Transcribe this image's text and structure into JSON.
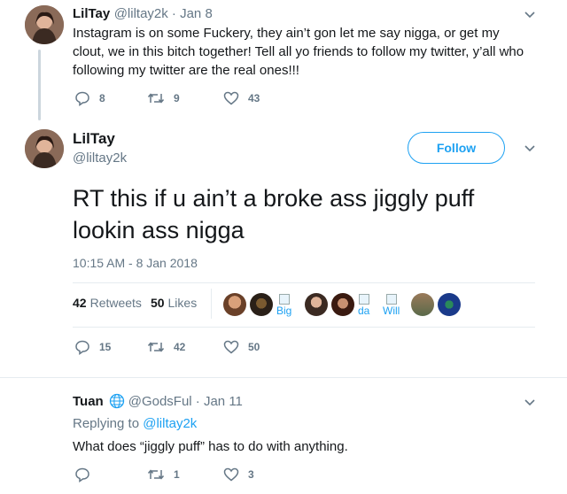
{
  "tweet1": {
    "name": "LilTay",
    "handle_date": "@liltay2k · Jan 8",
    "text": "Instagram is on some Fuckery, they ain’t gon let me say nigga, or get my clout, we in this bitch together! Tell all yo friends to follow my twitter, y’all who following my twitter are the real ones!!!",
    "replies": "8",
    "retweets": "9",
    "likes": "43"
  },
  "tweet2": {
    "name": "LilTay",
    "handle": "@liltay2k",
    "follow_label": "Follow",
    "text_line1": "RT this if u ain’t a broke ass jiggly puff",
    "text_line2": "lookin ass nigga",
    "timestamp": "10:15 AM - 8 Jan 2018",
    "retweet_count": "42",
    "retweet_word": "Retweets",
    "like_count": "50",
    "like_word": "Likes",
    "likers_broken": [
      "Big",
      "da",
      "Will"
    ],
    "replies": "15",
    "retweets": "42",
    "likes": "50"
  },
  "reply": {
    "name": "Tuan",
    "handle_date": "@GodsFul · Jan 11",
    "replying_prefix": "Replying to",
    "replying_to": "@liltay2k",
    "text": "What does “jiggly puff” has to do with anything.",
    "retweets": "1",
    "likes": "3"
  },
  "colors": {
    "accent": "#1da1f2",
    "muted": "#657786",
    "text": "#14171a"
  }
}
